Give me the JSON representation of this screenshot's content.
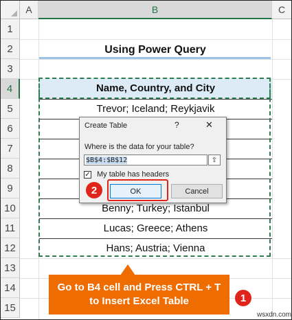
{
  "columns": [
    "A",
    "B",
    "C"
  ],
  "rows": [
    "1",
    "2",
    "3",
    "4",
    "5",
    "6",
    "7",
    "8",
    "9",
    "10",
    "11",
    "12",
    "13",
    "14",
    "15"
  ],
  "active_row": "4",
  "sheet_title": "Using Power Query",
  "table": {
    "header": "Name, Country, and City",
    "rows": [
      "Trevor; Iceland; Reykjavik",
      "",
      "",
      "",
      "",
      "Benny; Turkey; Istanbul",
      "Lucas; Greece; Athens",
      "Hans; Austria; Vienna"
    ]
  },
  "dialog": {
    "title": "Create Table",
    "help": "?",
    "close": "✕",
    "prompt": "Where is the data for your table?",
    "range_value": "$B$4:$B$12",
    "collapse_icon": "⇧",
    "checkbox_checked": true,
    "checkbox_mark": "✓",
    "checkbox_label": "My table has headers",
    "ok_label": "OK",
    "cancel_label": "Cancel"
  },
  "steps": {
    "step1": "1",
    "step2": "2"
  },
  "callout_text": "Go to B4 cell and Press CTRL + T to Insert Excel Table",
  "watermark": "wsxdn.com",
  "colors": {
    "accent_green": "#217346",
    "dash_green": "#2e7d4f",
    "header_fill": "#ddebf7",
    "highlight_red": "#e0241b",
    "callout_orange": "#ef6c00",
    "title_underline": "#9dc3e6"
  }
}
